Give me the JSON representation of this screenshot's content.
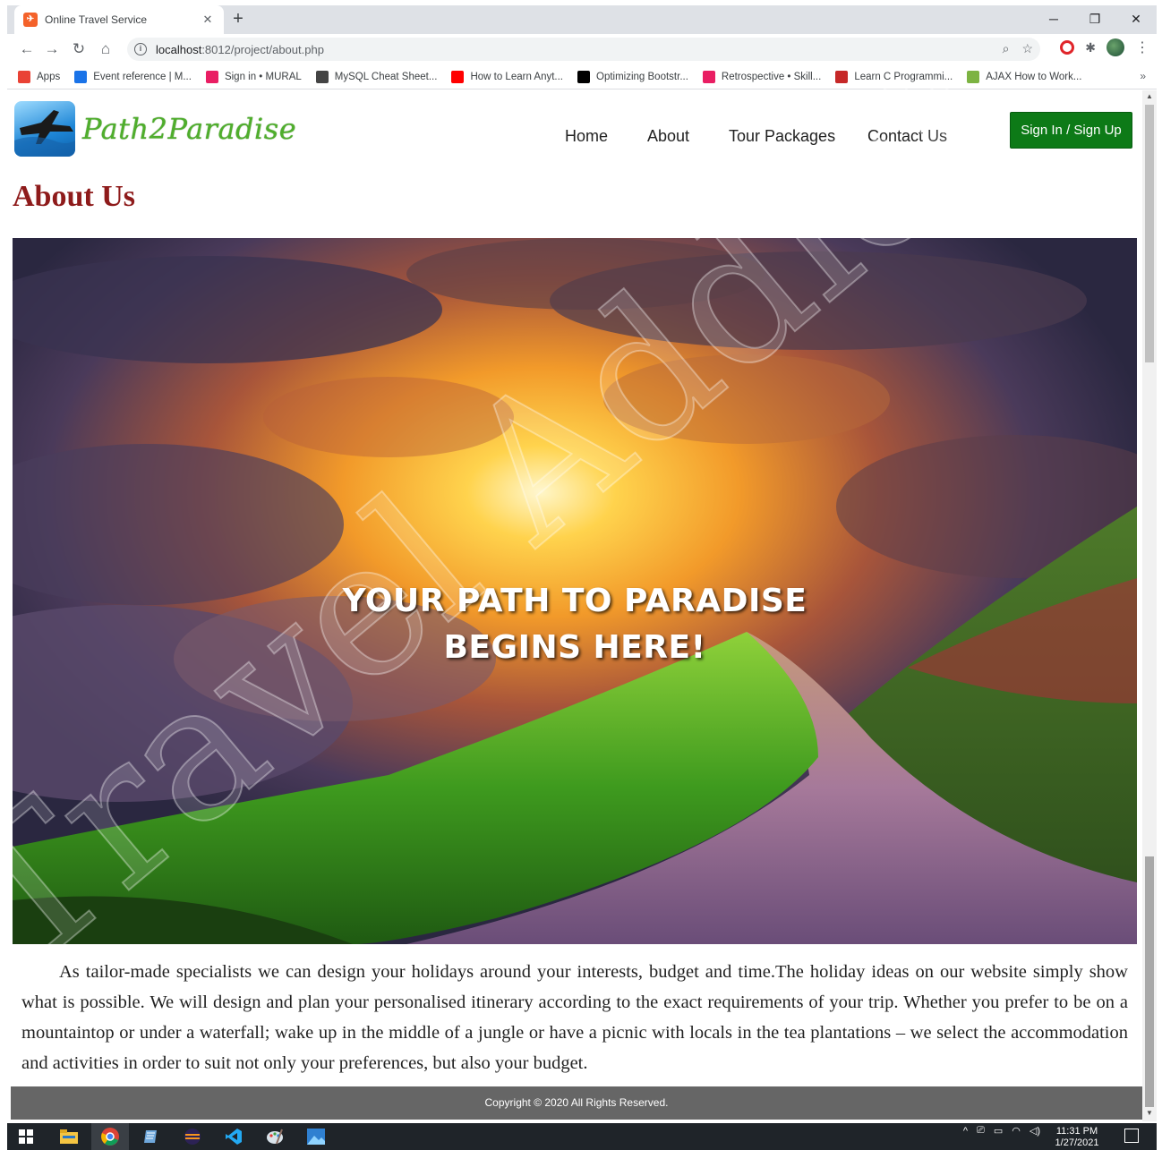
{
  "browser": {
    "tab_title": "Online Travel Service",
    "url_host": "localhost",
    "url_path": ":8012/project/about.php",
    "bookmarks": [
      {
        "label": "Apps",
        "color": "#e94235"
      },
      {
        "label": "Event reference | M...",
        "color": "#1a73e8"
      },
      {
        "label": "Sign in • MURAL",
        "color": "#e91e63"
      },
      {
        "label": "MySQL Cheat Sheet...",
        "color": "#444444"
      },
      {
        "label": "How to Learn Anyt...",
        "color": "#ff0000"
      },
      {
        "label": "Optimizing Bootstr...",
        "color": "#000000"
      },
      {
        "label": "Retrospective • Skill...",
        "color": "#e91e63"
      },
      {
        "label": "Learn C Programmi...",
        "color": "#c62828"
      },
      {
        "label": "AJAX How to Work...",
        "color": "#7cb342"
      }
    ],
    "bookmarks_overflow": "»"
  },
  "site": {
    "logo_text": "Path2Paradise",
    "nav": [
      {
        "label": "Home"
      },
      {
        "label": "About"
      },
      {
        "label": "Tour Packages"
      },
      {
        "label": "Contact Us"
      }
    ],
    "signin_label": "Sign In / Sign Up",
    "page_title": "About Us",
    "hero_caption": "YOUR PATH TO PARADISE BEGINS HERE!",
    "about_paragraph": "As tailor-made specialists we can design your holidays around your interests, budget and time.The holiday ideas on our website simply show what is possible. We will design and plan your personalised itinerary according to the exact requirements of your trip. Whether you prefer to be on a mountaintop or under a waterfall; wake up in the middle of a jungle or have a picnic with locals in the tea plantations – we select the accommodation and activities in order to suit not only your preferences, but also your budget.",
    "footer_text": "Copyright © 2020 All Rights Reserved.",
    "colors": {
      "title": "#8e1b1b",
      "signin_bg": "#0d7a17",
      "logo_text": "#4fae2c",
      "footer_bg": "#666666"
    }
  },
  "taskbar": {
    "time": "11:31 PM",
    "date": "1/27/2021"
  }
}
